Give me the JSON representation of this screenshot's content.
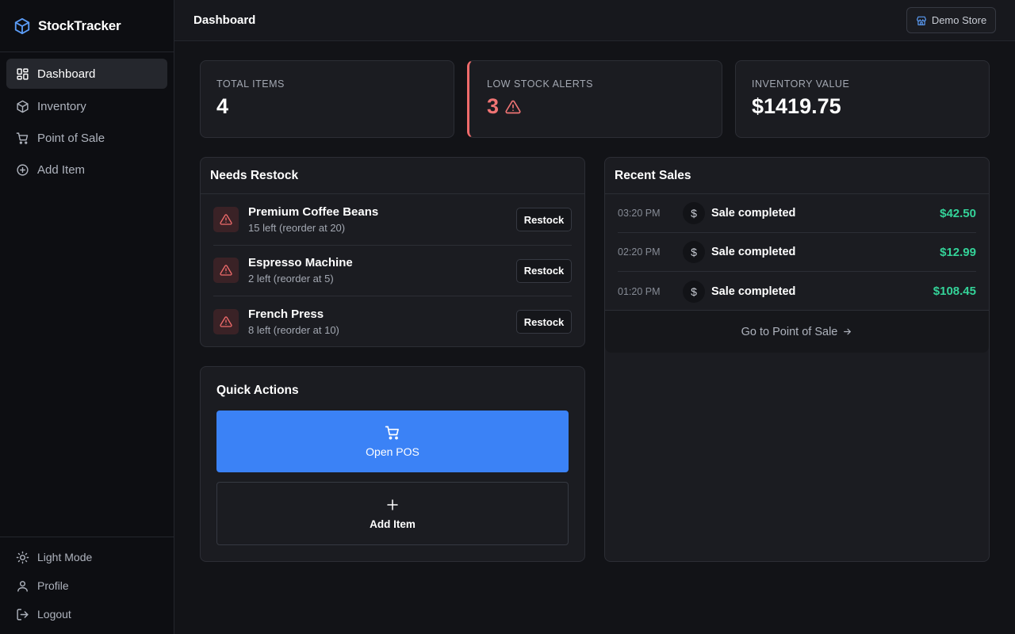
{
  "app": {
    "name": "StockTracker"
  },
  "sidebar": {
    "items": [
      {
        "label": "Dashboard",
        "icon": "dashboard-icon",
        "active": true
      },
      {
        "label": "Inventory",
        "icon": "box-icon",
        "active": false
      },
      {
        "label": "Point of Sale",
        "icon": "cart-icon",
        "active": false
      },
      {
        "label": "Add Item",
        "icon": "plus-circle-icon",
        "active": false
      }
    ],
    "bottom": [
      {
        "label": "Light Mode",
        "icon": "sun-icon"
      },
      {
        "label": "Profile",
        "icon": "user-icon"
      },
      {
        "label": "Logout",
        "icon": "logout-icon"
      }
    ]
  },
  "header": {
    "title": "Dashboard",
    "store_label": "Demo Store"
  },
  "stats": {
    "total_items": {
      "label": "TOTAL ITEMS",
      "value": "4"
    },
    "low_stock": {
      "label": "LOW STOCK ALERTS",
      "value": "3"
    },
    "inventory_value": {
      "label": "INVENTORY VALUE",
      "value": "$1419.75"
    }
  },
  "restock": {
    "title": "Needs Restock",
    "button_label": "Restock",
    "items": [
      {
        "name": "Premium Coffee Beans",
        "detail": "15 left (reorder at 20)"
      },
      {
        "name": "Espresso Machine",
        "detail": "2 left (reorder at 5)"
      },
      {
        "name": "French Press",
        "detail": "8 left (reorder at 10)"
      }
    ]
  },
  "sales": {
    "title": "Recent Sales",
    "items": [
      {
        "time": "03:20 PM",
        "text": "Sale completed",
        "amount": "$42.50"
      },
      {
        "time": "02:20 PM",
        "text": "Sale completed",
        "amount": "$12.99"
      },
      {
        "time": "01:20 PM",
        "text": "Sale completed",
        "amount": "$108.45"
      }
    ],
    "footer_link": "Go to Point of Sale"
  },
  "quick_actions": {
    "title": "Quick Actions",
    "open_pos": "Open POS",
    "add_item": "Add Item"
  },
  "colors": {
    "accent": "#3b82f6",
    "alert": "#ef6b6b",
    "success": "#34d399",
    "background": "#121317",
    "card": "#1b1c21"
  }
}
